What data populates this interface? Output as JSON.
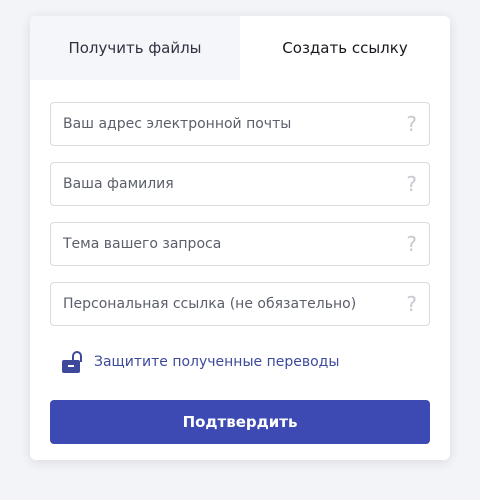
{
  "tabs": [
    {
      "label": "Получить файлы",
      "active": false
    },
    {
      "label": "Создать ссылку",
      "active": true
    }
  ],
  "form": {
    "fields": [
      {
        "placeholder": "Ваш адрес электронной почты",
        "value": "",
        "help_icon": "question-icon"
      },
      {
        "placeholder": "Ваша фамилия",
        "value": "",
        "help_icon": "question-icon"
      },
      {
        "placeholder": "Тема вашего запроса",
        "value": "",
        "help_icon": "question-icon"
      },
      {
        "placeholder": "Персональная ссылка (не обязательно)",
        "value": "",
        "help_icon": "question-icon"
      }
    ],
    "help_glyph": "?",
    "protect_label": "Защитите полученные переводы",
    "protect_icon": "lock-icon",
    "submit_label": "Подтвердить"
  },
  "colors": {
    "accent": "#3d4ab3",
    "link": "#3d4a9c",
    "background": "#f3f4f7",
    "inactive_tab": "#f5f6f9"
  }
}
